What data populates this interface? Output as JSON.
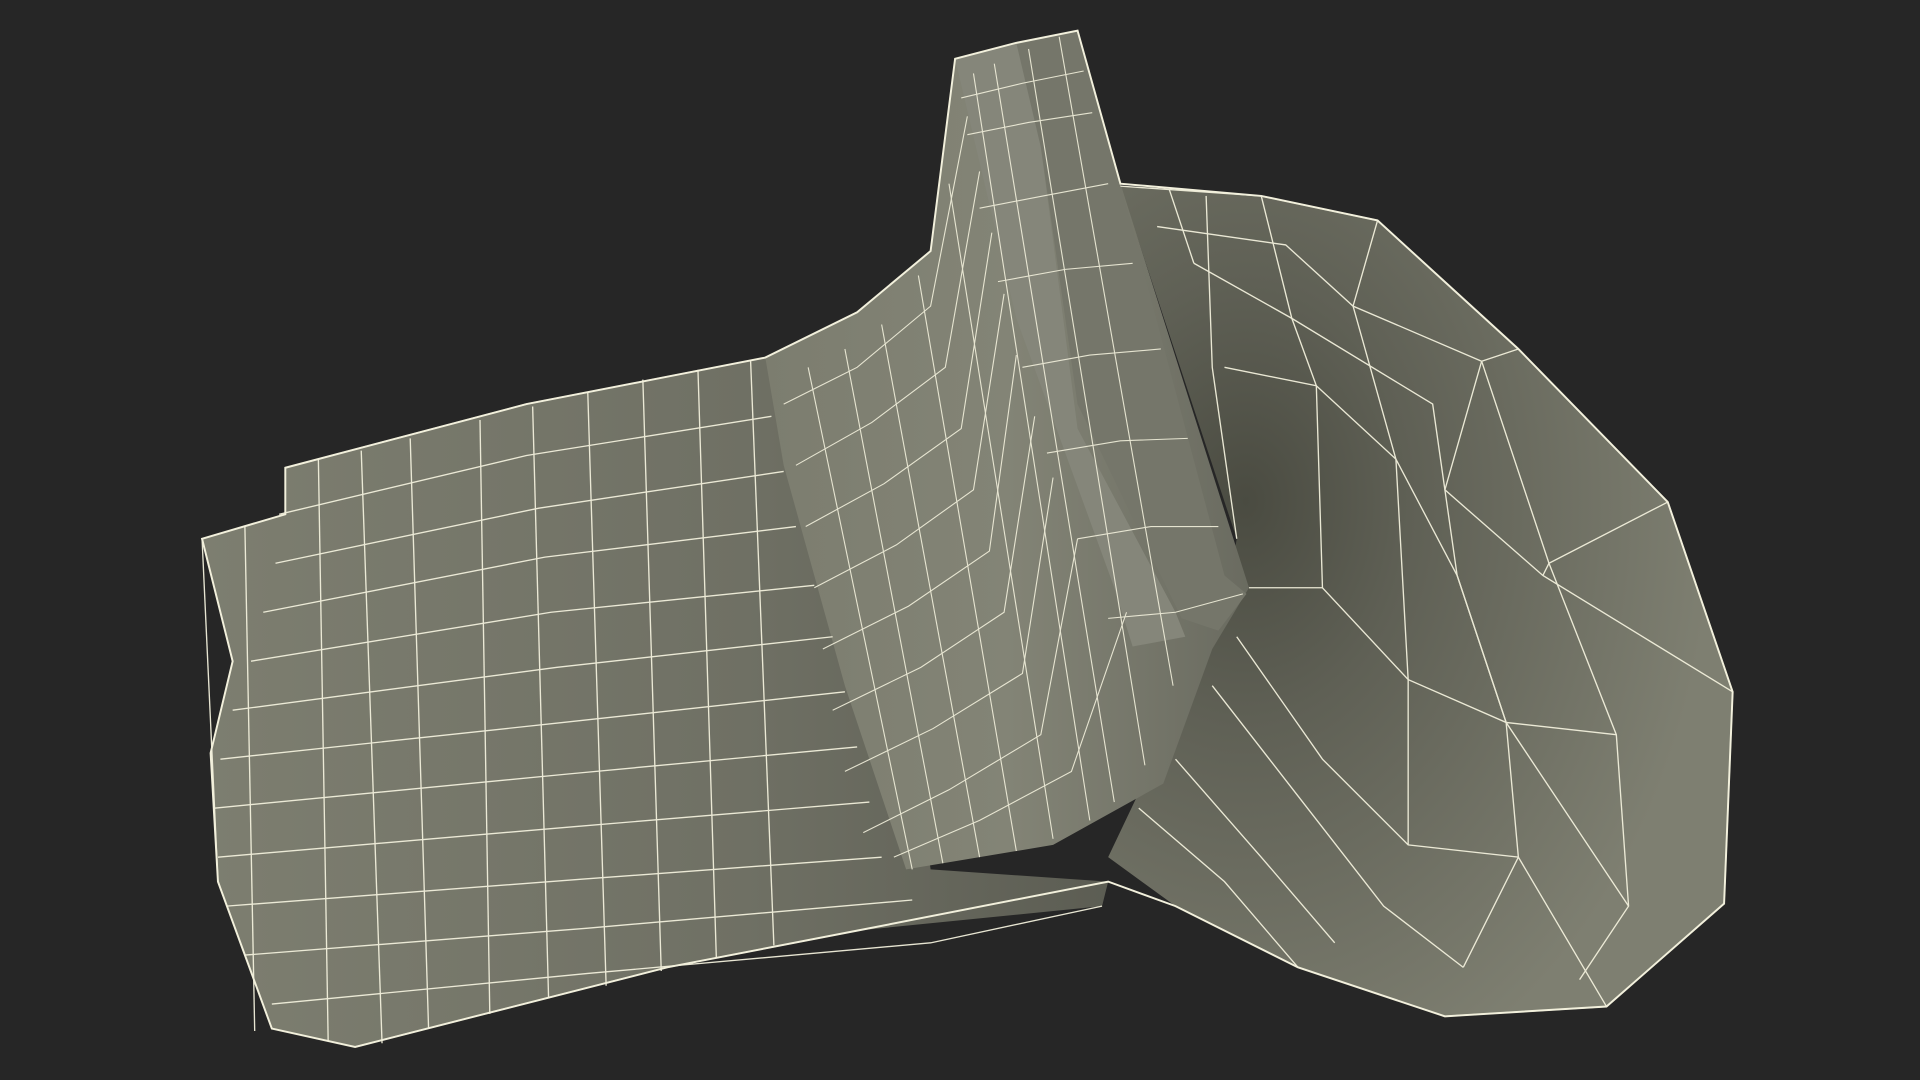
{
  "scene": {
    "background_color": "#262626",
    "mesh_fill_color": "#7b7c6e",
    "mesh_shade_color": "#4e4f45",
    "wire_color": "#f2f0dc",
    "render_mode": "wireframe-on-shaded",
    "subject": "low-poly-mesh-model"
  }
}
